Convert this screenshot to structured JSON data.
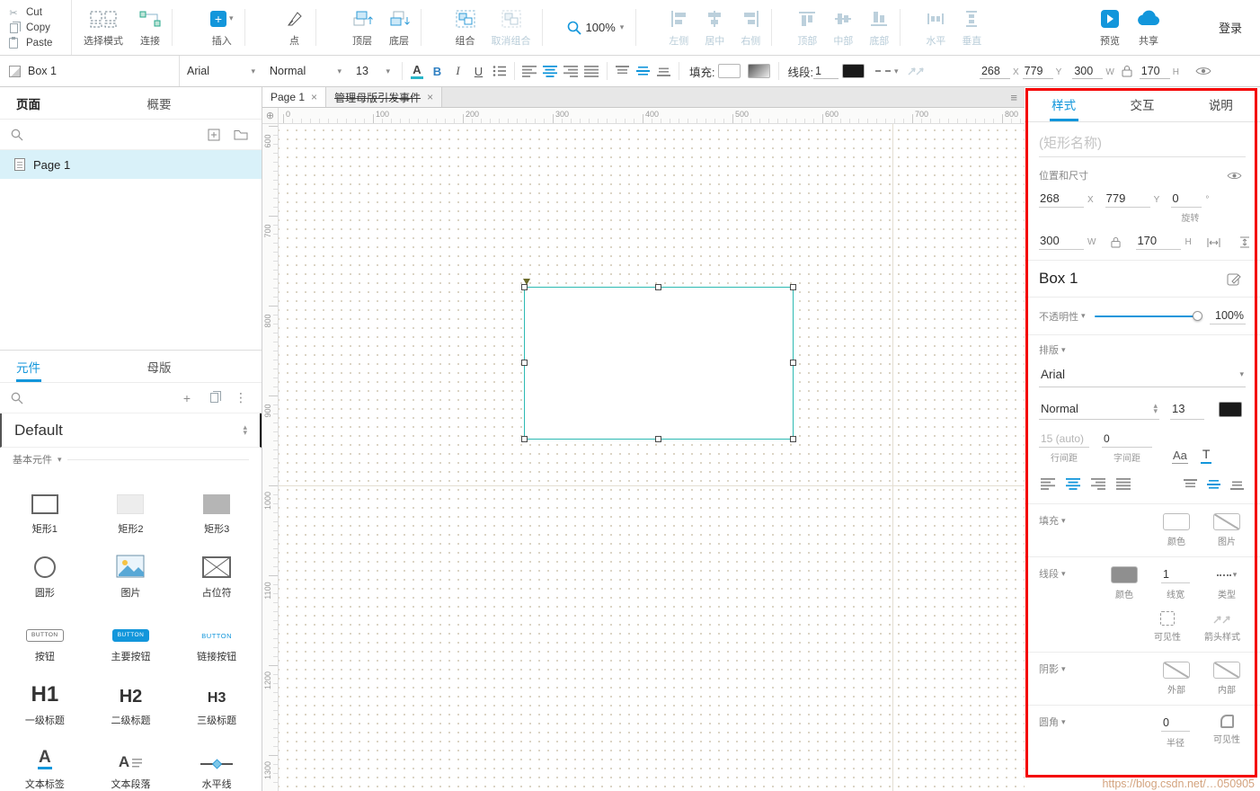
{
  "icons": {
    "scissors": "✂",
    "chevron_down": "▾",
    "chevron_up": "▴",
    "plus": "+",
    "dots_menu": "⋮",
    "tab_menu": "≡",
    "close": "×",
    "crosshair": "⊕"
  },
  "edit_menu": {
    "cut": "Cut",
    "copy": "Copy",
    "paste": "Paste"
  },
  "toolbar": {
    "selection_mode": "选择模式",
    "connect": "连接",
    "insert": "插入",
    "point": "点",
    "top_layer": "顶层",
    "bottom_layer": "底层",
    "group": "组合",
    "ungroup": "取消组合",
    "zoom_value": "100%",
    "align_left": "左侧",
    "align_center": "居中",
    "align_right": "右侧",
    "align_top": "顶部",
    "align_middle": "中部",
    "align_bottom": "底部",
    "distribute_h": "水平",
    "distribute_v": "垂直",
    "preview": "预览",
    "share": "共享",
    "login": "登录"
  },
  "format_bar": {
    "widget_name": "Box 1",
    "font_family": "Arial",
    "font_style": "Normal",
    "font_size": "13",
    "bold": "B",
    "italic": "I",
    "underline": "U",
    "color_letter": "A",
    "fill_label": "填充:",
    "line_label": "线段:",
    "line_width": "1",
    "x_value": "268",
    "x_label": "X",
    "y_value": "779",
    "y_label": "Y",
    "w_value": "300",
    "w_label": "W",
    "h_value": "170",
    "h_label": "H"
  },
  "pages_panel": {
    "tab_pages": "页面",
    "tab_outline": "概要",
    "items": [
      {
        "label": "Page 1"
      }
    ]
  },
  "widgets_panel": {
    "tab_widgets": "元件",
    "tab_masters": "母版",
    "library": "Default",
    "section": "基本元件",
    "items": [
      {
        "label": "矩形1"
      },
      {
        "label": "矩形2"
      },
      {
        "label": "矩形3"
      },
      {
        "label": "圆形"
      },
      {
        "label": "图片"
      },
      {
        "label": "占位符"
      },
      {
        "label": "按钮",
        "glyph": "BUTTON"
      },
      {
        "label": "主要按钮",
        "glyph": "BUTTON"
      },
      {
        "label": "链接按钮",
        "glyph": "BUTTON"
      },
      {
        "label": "一级标题",
        "glyph": "H1"
      },
      {
        "label": "二级标题",
        "glyph": "H2"
      },
      {
        "label": "三级标题",
        "glyph": "H3"
      },
      {
        "label": "文本标签",
        "glyph": "A"
      },
      {
        "label": "文本段落",
        "glyph": "A"
      },
      {
        "label": "水平线"
      }
    ]
  },
  "canvas": {
    "tabs": [
      {
        "label": "Page 1"
      },
      {
        "label": "管理母版引发事件"
      }
    ],
    "h_ruler": [
      "0",
      "100",
      "200",
      "300",
      "400",
      "500",
      "600",
      "700",
      "800"
    ],
    "v_ruler": [
      "600",
      "700",
      "800",
      "900",
      "1000",
      "1100",
      "1200",
      "1300"
    ]
  },
  "style_panel": {
    "tab_style": "样式",
    "tab_interaction": "交互",
    "tab_notes": "说明",
    "name_placeholder": "(矩形名称)",
    "position_section": "位置和尺寸",
    "x_value": "268",
    "x_label": "X",
    "y_value": "779",
    "y_label": "Y",
    "rotate_value": "0",
    "rotate_unit": "°",
    "rotate_label": "旋转",
    "w_value": "300",
    "w_label": "W",
    "h_value": "170",
    "h_label": "H",
    "widget_title": "Box 1",
    "opacity_label": "不透明性",
    "opacity_value": "100%",
    "typography_label": "排版",
    "font_family": "Arial",
    "font_style": "Normal",
    "font_size": "13",
    "line_spacing_value": "15 (auto)",
    "line_spacing_label": "行间距",
    "letter_spacing_value": "0",
    "letter_spacing_label": "字间距",
    "case_icon": "Aa",
    "transform_icon": "T",
    "fill_section": "填充",
    "fill_color_label": "颜色",
    "fill_image_label": "图片",
    "line_section": "线段",
    "line_color_label": "颜色",
    "line_width_value": "1",
    "line_width_label": "线宽",
    "line_type_label": "类型",
    "line_visibility_label": "可见性",
    "arrow_style_label": "箭头样式",
    "shadow_section": "阴影",
    "shadow_outer_label": "外部",
    "shadow_inner_label": "内部",
    "corner_section": "圆角",
    "corner_radius_value": "0",
    "corner_radius_label": "半径",
    "corner_visibility_label": "可见性",
    "watermark": "https://blog.csdn.net/…050905"
  }
}
